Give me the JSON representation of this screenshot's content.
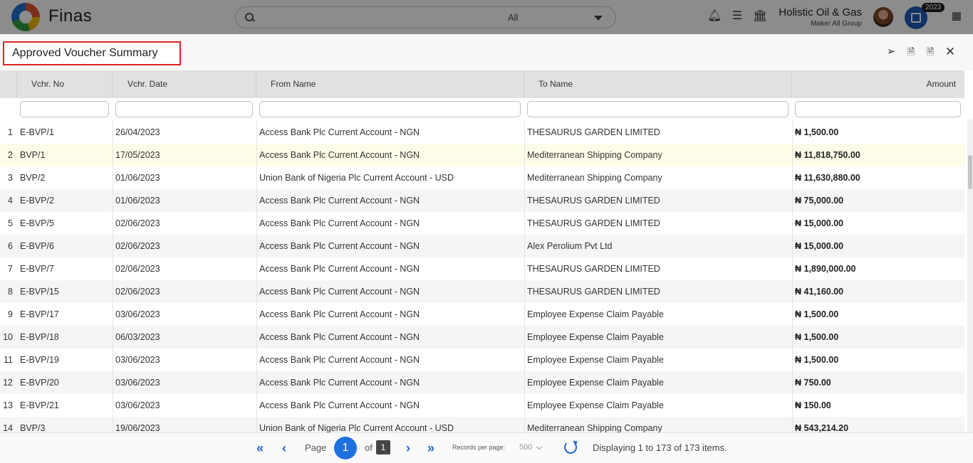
{
  "app": {
    "brand": "Finas",
    "search_scope": "All",
    "company": "Holistic Oil & Gas",
    "role": "Maker All Group",
    "year_badge": "2023"
  },
  "panel": {
    "title": "Approved Voucher Summary"
  },
  "columns": [
    "Vchr. No",
    "Vchr. Date",
    "From Name",
    "To Name",
    "Amount"
  ],
  "rows": [
    {
      "n": "1",
      "no": "E-BVP/1",
      "date": "26/04/2023",
      "from": "Access Bank Plc Current Account - NGN",
      "to": "THESAURUS GARDEN LIMITED",
      "amount": "₦ 1,500.00"
    },
    {
      "n": "2",
      "no": "BVP/1",
      "date": "17/05/2023",
      "from": "Access Bank Plc Current Account - NGN",
      "to": "Mediterranean Shipping Company",
      "amount": "₦ 11,818,750.00"
    },
    {
      "n": "3",
      "no": "BVP/2",
      "date": "01/06/2023",
      "from": "Union Bank of Nigeria Plc Current Account - USD",
      "to": "Mediterranean Shipping Company",
      "amount": "₦ 11,630,880.00"
    },
    {
      "n": "4",
      "no": "E-BVP/2",
      "date": "01/06/2023",
      "from": "Access Bank Plc Current Account - NGN",
      "to": "THESAURUS GARDEN LIMITED",
      "amount": "₦ 75,000.00"
    },
    {
      "n": "5",
      "no": "E-BVP/5",
      "date": "02/06/2023",
      "from": "Access Bank Plc Current Account - NGN",
      "to": "THESAURUS GARDEN LIMITED",
      "amount": "₦ 15,000.00"
    },
    {
      "n": "6",
      "no": "E-BVP/6",
      "date": "02/06/2023",
      "from": "Access Bank Plc Current Account - NGN",
      "to": "Alex Perolium Pvt Ltd",
      "amount": "₦ 15,000.00"
    },
    {
      "n": "7",
      "no": "E-BVP/7",
      "date": "02/06/2023",
      "from": "Access Bank Plc Current Account - NGN",
      "to": "THESAURUS GARDEN LIMITED",
      "amount": "₦ 1,890,000.00"
    },
    {
      "n": "8",
      "no": "E-BVP/15",
      "date": "02/06/2023",
      "from": "Access Bank Plc Current Account - NGN",
      "to": "THESAURUS GARDEN LIMITED",
      "amount": "₦ 41,160.00"
    },
    {
      "n": "9",
      "no": "E-BVP/17",
      "date": "03/06/2023",
      "from": "Access Bank Plc Current Account - NGN",
      "to": "Employee Expense Claim Payable",
      "amount": "₦ 1,500.00"
    },
    {
      "n": "10",
      "no": "E-BVP/18",
      "date": "06/03/2023",
      "from": "Access Bank Plc Current Account - NGN",
      "to": "Employee Expense Claim Payable",
      "amount": "₦ 1,500.00"
    },
    {
      "n": "11",
      "no": "E-BVP/19",
      "date": "03/06/2023",
      "from": "Access Bank Plc Current Account - NGN",
      "to": "Employee Expense Claim Payable",
      "amount": "₦ 1,500.00"
    },
    {
      "n": "12",
      "no": "E-BVP/20",
      "date": "03/06/2023",
      "from": "Access Bank Plc Current Account - NGN",
      "to": "Employee Expense Claim Payable",
      "amount": "₦ 750.00"
    },
    {
      "n": "13",
      "no": "E-BVP/21",
      "date": "03/06/2023",
      "from": "Access Bank Plc Current Account - NGN",
      "to": "Employee Expense Claim Payable",
      "amount": "₦ 150.00"
    },
    {
      "n": "14",
      "no": "BVP/3",
      "date": "19/06/2023",
      "from": "Union Bank of Nigeria Plc Current Account - USD",
      "to": "Mediterranean Shipping Company",
      "amount": "₦ 543,214.20"
    }
  ],
  "pager": {
    "page_label": "Page",
    "current": "1",
    "of_label": "of",
    "total_pages": "1",
    "records_label": "Records per page:",
    "records_value": "500",
    "display": "Displaying 1 to 173 of 173 items."
  }
}
